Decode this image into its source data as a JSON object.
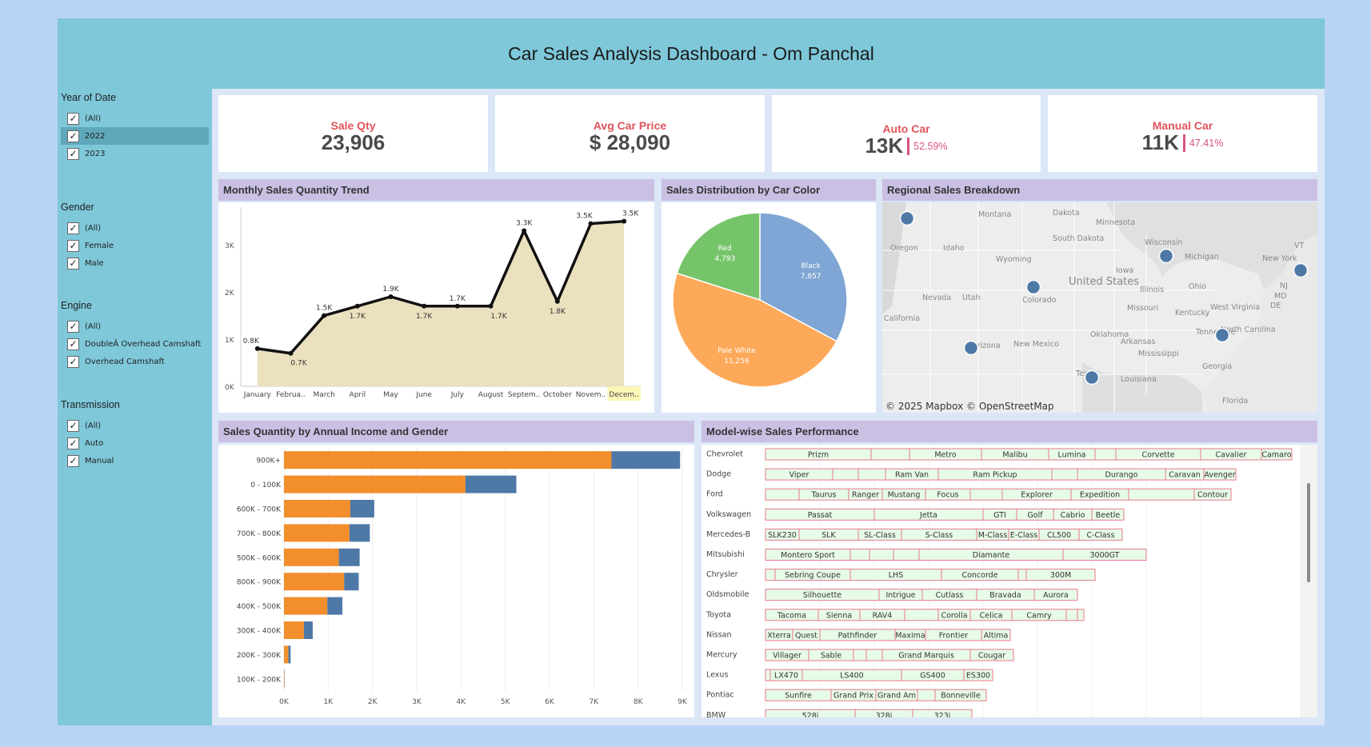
{
  "title": "Car Sales Analysis Dashboard - Om Panchal",
  "filters": {
    "year": {
      "title": "Year of  Date",
      "items": [
        {
          "label": "(All)"
        },
        {
          "label": "2022",
          "highlight": true
        },
        {
          "label": "2023"
        }
      ]
    },
    "gender": {
      "title": "Gender",
      "items": [
        {
          "label": "(All)"
        },
        {
          "label": "Female"
        },
        {
          "label": "Male"
        }
      ]
    },
    "engine": {
      "title": "Engine",
      "items": [
        {
          "label": "(All)"
        },
        {
          "label": "DoubleÂ Overhead Camshaft"
        },
        {
          "label": "Overhead Camshaft"
        }
      ]
    },
    "transmission": {
      "title": "Transmission",
      "items": [
        {
          "label": "(All)"
        },
        {
          "label": "Auto"
        },
        {
          "label": "Manual"
        }
      ]
    }
  },
  "kpis": {
    "sale_qty": {
      "label": "Sale Qty",
      "value": "23,906"
    },
    "avg_price": {
      "label": "Avg Car Price",
      "value": "$ 28,090"
    },
    "auto": {
      "label": "Auto Car",
      "value": "13K",
      "pct": "52.59%"
    },
    "manual": {
      "label": "Manual Car",
      "value": "11K",
      "pct": "47.41%"
    }
  },
  "panels": {
    "monthly": "Monthly Sales Quantity Trend",
    "color": "Sales Distribution by Car Color",
    "regional": "Regional Sales Breakdown",
    "income": "Sales Quantity by Annual Income and Gender",
    "model": "Model-wise Sales Performance"
  },
  "map": {
    "attribution": "© 2025 Mapbox © OpenStreetMap",
    "labels": [
      "Montana",
      "Dakota",
      "Minnesota",
      "Oregon",
      "Idaho",
      "South Dakota",
      "Wisconsin",
      "Michigan",
      "VT",
      "New York",
      "Wyoming",
      "Iowa",
      "United States",
      "NJ",
      "Nevada",
      "Utah",
      "Colorado",
      "Illinois",
      "Ohio",
      "MD",
      "DE",
      "West Virginia",
      "Missouri",
      "Kentucky",
      "California",
      "Oklahoma",
      "Tennessee",
      "North Carolina",
      "Arizona",
      "New Mexico",
      "Arkansas",
      "Mississippi",
      "Georgia",
      "Texas",
      "Louisiana",
      "Florida"
    ]
  },
  "colors": {
    "orange": "#f28e2b",
    "blue": "#4e79a7",
    "area_fill": "#ebe1bf",
    "pie_black": "#7fa6d4",
    "pie_pale_white": "#fda95a",
    "pie_red": "#76c46a",
    "kpi_red": "#e0545c",
    "header_purple": "#c9c0e4"
  },
  "chart_data": [
    {
      "type": "line",
      "title": "Monthly Sales Quantity Trend",
      "categories": [
        "January",
        "Februa..",
        "March",
        "April",
        "May",
        "June",
        "July",
        "August",
        "Septem..",
        "October",
        "Novem..",
        "Decem.."
      ],
      "values": [
        800,
        700,
        1500,
        1700,
        1900,
        1700,
        1700,
        1700,
        3300,
        1800,
        3450,
        3500
      ],
      "data_labels": [
        "0.8K",
        "0.7K",
        "1.5K",
        "1.7K",
        "1.9K",
        "1.7K",
        "1.7K",
        "1.7K",
        "3.3K",
        "1.8K",
        "3.5K",
        "3.5K"
      ],
      "y_ticks": [
        "0K",
        "1K",
        "2K",
        "3K"
      ],
      "ylim": [
        0,
        3800
      ]
    },
    {
      "type": "pie",
      "title": "Sales Distribution by Car Color",
      "slices": [
        {
          "name": "Black",
          "value": 7857,
          "label": "7,857"
        },
        {
          "name": "Pale White",
          "value": 11256,
          "label": "11,256"
        },
        {
          "name": "Red",
          "value": 4793,
          "label": "4,793"
        }
      ]
    },
    {
      "type": "bar",
      "title": "Sales Quantity by Annual Income and Gender",
      "categories": [
        "900K+",
        "0 - 100K",
        "600K - 700K",
        "700K - 800K",
        "500K - 600K",
        "800K - 900K",
        "400K - 500K",
        "300K - 400K",
        "200K - 300K",
        "100K - 200K"
      ],
      "series": [
        {
          "values": [
            7400,
            4100,
            1500,
            1480,
            1240,
            1360,
            980,
            450,
            100,
            10
          ]
        },
        {
          "values": [
            1550,
            1150,
            540,
            460,
            470,
            330,
            340,
            200,
            50,
            5
          ]
        }
      ],
      "x_ticks": [
        "0K",
        "1K",
        "2K",
        "3K",
        "4K",
        "5K",
        "6K",
        "7K",
        "8K",
        "9K"
      ],
      "xlim": [
        0,
        9000
      ]
    },
    {
      "type": "table",
      "title": "Model-wise Sales Performance",
      "rows": [
        {
          "brand": "Chevrolet",
          "models": [
            {
              "name": "Prizm",
              "w": 132
            },
            {
              "name": "",
              "w": 48
            },
            {
              "name": "Metro",
              "w": 90
            },
            {
              "name": "Malibu",
              "w": 84
            },
            {
              "name": "Lumina",
              "w": 58
            },
            {
              "name": "",
              "w": 26
            },
            {
              "name": "Corvette",
              "w": 106
            },
            {
              "name": "Cavalier",
              "w": 76
            },
            {
              "name": "Camaro",
              "w": 38
            }
          ]
        },
        {
          "brand": "Dodge",
          "models": [
            {
              "name": "Viper",
              "w": 84
            },
            {
              "name": "",
              "w": 32
            },
            {
              "name": "",
              "w": 34
            },
            {
              "name": "Ram Van",
              "w": 66
            },
            {
              "name": "Ram Pickup",
              "w": 142
            },
            {
              "name": "",
              "w": 32
            },
            {
              "name": "Durango",
              "w": 110
            },
            {
              "name": "Caravan",
              "w": 48
            },
            {
              "name": "Avenger",
              "w": 40
            }
          ]
        },
        {
          "brand": "Ford",
          "models": [
            {
              "name": "",
              "w": 42
            },
            {
              "name": "Taurus",
              "w": 62
            },
            {
              "name": "Ranger",
              "w": 42
            },
            {
              "name": "Mustang",
              "w": 54
            },
            {
              "name": "Focus",
              "w": 56
            },
            {
              "name": "",
              "w": 40
            },
            {
              "name": "Explorer",
              "w": 86
            },
            {
              "name": "Expedition",
              "w": 72
            },
            {
              "name": "",
              "w": 82
            },
            {
              "name": "Contour",
              "w": 46
            }
          ]
        },
        {
          "brand": "Volkswagen",
          "models": [
            {
              "name": "Passat",
              "w": 136
            },
            {
              "name": "Jetta",
              "w": 136
            },
            {
              "name": "GTI",
              "w": 42
            },
            {
              "name": "Golf",
              "w": 46
            },
            {
              "name": "Cabrio",
              "w": 48
            },
            {
              "name": "Beetle",
              "w": 40
            }
          ]
        },
        {
          "brand": "Mercedes-B",
          "models": [
            {
              "name": "SLK230",
              "w": 42
            },
            {
              "name": "SLK",
              "w": 74
            },
            {
              "name": "SL-Class",
              "w": 54
            },
            {
              "name": "S-Class",
              "w": 94
            },
            {
              "name": "M-Class",
              "w": 40
            },
            {
              "name": "E-Class",
              "w": 38
            },
            {
              "name": "CL500",
              "w": 50
            },
            {
              "name": "C-Class",
              "w": 54
            }
          ]
        },
        {
          "brand": "Mitsubishi",
          "models": [
            {
              "name": "Montero Sport",
              "w": 106
            },
            {
              "name": "",
              "w": 24
            },
            {
              "name": "",
              "w": 30
            },
            {
              "name": "",
              "w": 32
            },
            {
              "name": "Diamante",
              "w": 180
            },
            {
              "name": "3000GT",
              "w": 104
            }
          ]
        },
        {
          "brand": "Chrysler",
          "models": [
            {
              "name": "",
              "w": 12
            },
            {
              "name": "Sebring Coupe",
              "w": 94
            },
            {
              "name": "LHS",
              "w": 114
            },
            {
              "name": "Concorde",
              "w": 96
            },
            {
              "name": "",
              "w": 10
            },
            {
              "name": "300M",
              "w": 86
            }
          ]
        },
        {
          "brand": "Oldsmobile",
          "models": [
            {
              "name": "Silhouette",
              "w": 142
            },
            {
              "name": "Intrigue",
              "w": 54
            },
            {
              "name": "Cutlass",
              "w": 68
            },
            {
              "name": "Bravada",
              "w": 72
            },
            {
              "name": "Aurora",
              "w": 54
            }
          ]
        },
        {
          "brand": "Toyota",
          "models": [
            {
              "name": "Tacoma",
              "w": 66
            },
            {
              "name": "Sienna",
              "w": 52
            },
            {
              "name": "RAV4",
              "w": 56
            },
            {
              "name": "",
              "w": 42
            },
            {
              "name": "Corolla",
              "w": 40
            },
            {
              "name": "Celica",
              "w": 52
            },
            {
              "name": "Camry",
              "w": 68
            },
            {
              "name": "",
              "w": 14
            },
            {
              "name": "",
              "w": 8
            }
          ]
        },
        {
          "brand": "Nissan",
          "models": [
            {
              "name": "Xterra",
              "w": 34
            },
            {
              "name": "Quest",
              "w": 34
            },
            {
              "name": "Pathfinder",
              "w": 94
            },
            {
              "name": "Maxima",
              "w": 38
            },
            {
              "name": "Frontier",
              "w": 70
            },
            {
              "name": "Altima",
              "w": 36
            }
          ]
        },
        {
          "brand": "Mercury",
          "models": [
            {
              "name": "Villager",
              "w": 54
            },
            {
              "name": "Sable",
              "w": 56
            },
            {
              "name": "",
              "w": 16
            },
            {
              "name": "",
              "w": 20
            },
            {
              "name": "Grand Marquis",
              "w": 110
            },
            {
              "name": "Cougar",
              "w": 54
            }
          ]
        },
        {
          "brand": "Lexus",
          "models": [
            {
              "name": "",
              "w": 6
            },
            {
              "name": "LX470",
              "w": 40
            },
            {
              "name": "LS400",
              "w": 124
            },
            {
              "name": "GS400",
              "w": 78
            },
            {
              "name": "ES300",
              "w": 36
            }
          ]
        },
        {
          "brand": "Pontiac",
          "models": [
            {
              "name": "Sunfire",
              "w": 82
            },
            {
              "name": "Grand Prix",
              "w": 56
            },
            {
              "name": "Grand Am",
              "w": 52
            },
            {
              "name": "",
              "w": 22
            },
            {
              "name": "Bonneville",
              "w": 64
            }
          ]
        },
        {
          "brand": "BMW",
          "models": [
            {
              "name": "528i",
              "w": 112
            },
            {
              "name": "328i",
              "w": 72
            },
            {
              "name": "323i",
              "w": 74
            }
          ]
        }
      ]
    }
  ]
}
